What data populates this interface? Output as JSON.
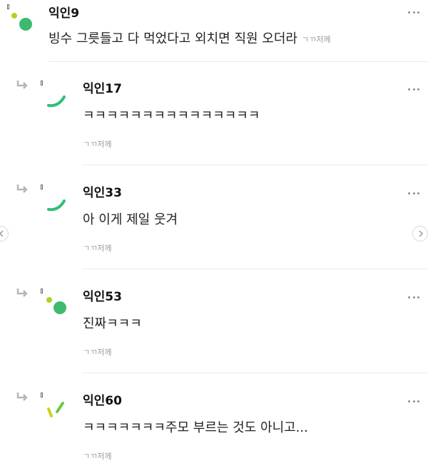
{
  "comments": [
    {
      "nickname": "익인9",
      "text": "빙수 그릇들고 다 먹었다고 외치면 직원 오더라",
      "meta": "ㄱㄲ저께"
    },
    {
      "nickname": "익인17",
      "text": "ㅋㅋㅋㅋㅋㅋㅋㅋㅋㅋㅋㅋㅋㅋㅋ",
      "meta": "ㄱㄲ저께"
    },
    {
      "nickname": "익인33",
      "text": "아 이게 제일 웃겨",
      "meta": "ㄱㄲ저께"
    },
    {
      "nickname": "익인53",
      "text": "진짜ㅋㅋㅋ",
      "meta": "ㄱㄲ저께"
    },
    {
      "nickname": "익인60",
      "text": "ㅋㅋㅋㅋㅋㅋㅋ주모 부르는 것도 아니고...",
      "meta": "ㄱㄲ저께"
    }
  ],
  "icons": {
    "avatar_green": "#3dba6f",
    "avatar_lime": "#a8d424",
    "avatar_yellow": "#c9d422",
    "reply_arrow": "reply-arrow-icon",
    "more": "more-options-icon",
    "nav_prev": "chevron-left-icon",
    "nav_next": "chevron-right-icon"
  }
}
